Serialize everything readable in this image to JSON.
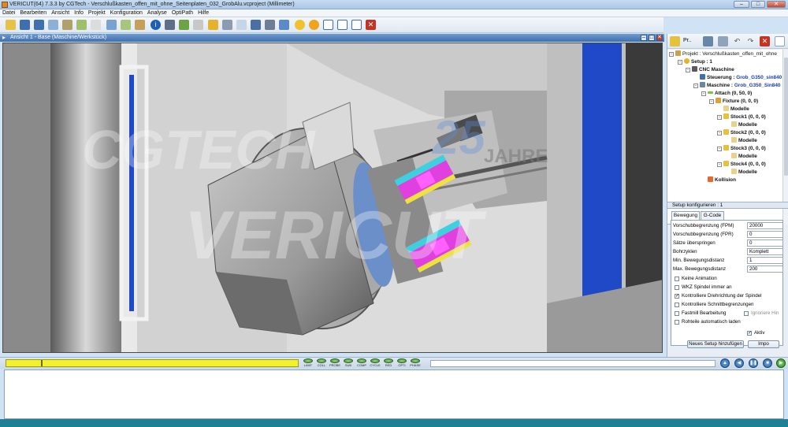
{
  "window": {
    "title": "VERICUT(64)   7.3.3 by CGTech - Verschlußkasten_offen_mit_ohne_Seitenplaten_032_GrobAlu.vcproject (Millimeter)",
    "buttons": {
      "minimize": "–",
      "maximize": "□",
      "close": "✕"
    }
  },
  "menu": {
    "items": [
      "Datei",
      "Bearbeiten",
      "Ansicht",
      "Info",
      "Projekt",
      "Konfiguration",
      "Analyse",
      "OptiPath",
      "Hilfe"
    ]
  },
  "view": {
    "title": "Ansicht 1 - Base (Maschine/Werkstück)",
    "watermark_top": "CGTECH",
    "watermark_bottom": "VERICUT",
    "watermark_jahre": "JAHRE",
    "watermark_number": "25"
  },
  "right_panel": {
    "toolbar_label": "Pr..",
    "tree": {
      "root": "Projekt : Verschlußkasten_offen_mit_ohne",
      "setup": "Setup : 1",
      "cnc": "CNC Maschine",
      "steuerung_label": "Steuerung :",
      "steuerung_value": "Grob_G350_sin840",
      "maschine_label": "Maschine :",
      "maschine_value": "Grob_G350_Sin840",
      "attach": "Attach (0, 50, 0)",
      "fixture": "Fixture (0, 0, 0)",
      "modelle": "Modelle",
      "stocks": [
        {
          "name": "Stock1 (0, 0, 0)",
          "child": "Modelle"
        },
        {
          "name": "Stock2 (0, 0, 0)",
          "child": "Modelle"
        },
        {
          "name": "Stock3 (0, 0, 0)",
          "child": "Modelle"
        },
        {
          "name": "Stock4 (0, 0, 0)",
          "child": "Modelle"
        }
      ],
      "kollision": "Kollision"
    },
    "config": {
      "header": "Setup konfigurieren : 1",
      "tabs": [
        "Bewegung",
        "G-Code"
      ],
      "params": [
        {
          "label": "Vorschubbegrenzung (FPM)",
          "value": "20000"
        },
        {
          "label": "Vorschubbegrenzung (FPR)",
          "value": "0"
        },
        {
          "label": "Sätze überspringen",
          "value": "0"
        },
        {
          "label": "Bohrzyklen",
          "value": "Komplett"
        },
        {
          "label": "Min. Bewegungsdistanz",
          "value": "1"
        },
        {
          "label": "Max. Bewegungsdistanz",
          "value": "200"
        }
      ],
      "checks": [
        {
          "label": "Keine Animation",
          "checked": false
        },
        {
          "label": "WKZ Spindel immer an",
          "checked": false
        },
        {
          "label": "Kontrolliere Drehrichtung der Spindel",
          "checked": true
        },
        {
          "label": "Kontrolliere Schnittbegrenzungen",
          "checked": false
        },
        {
          "label": "Fastmill Bearbeitung",
          "checked": false
        },
        {
          "label": "Rohteile automatisch laden",
          "checked": false
        }
      ],
      "ignore_label": "Ignoriere Hin",
      "aktiv_label": "Aktiv",
      "aktiv_checked": true,
      "add_setup_button": "Neues Setup hinzufügen",
      "import_button": "Impo"
    }
  },
  "bottom": {
    "leds": [
      "LIMIT",
      "COLL",
      "PROBE",
      "SUB",
      "COMP",
      "CYCLE",
      "RED",
      "OPTI",
      "PHASE"
    ],
    "progress_fraction": 0.12
  },
  "colors": {
    "accent": "#3f6fae",
    "progress": "#f2f22b",
    "status": "#1f7f96"
  }
}
